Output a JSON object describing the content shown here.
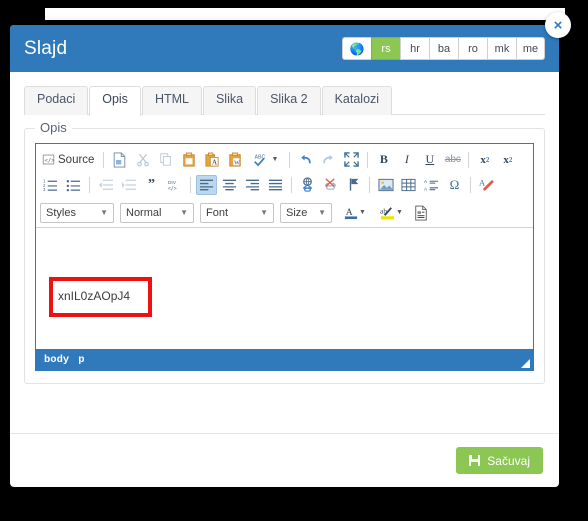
{
  "modal": {
    "title": "Slajd",
    "close_label": "×",
    "languages": [
      {
        "label": "globe-icon",
        "active": false,
        "is_icon": true
      },
      {
        "label": "rs",
        "active": true
      },
      {
        "label": "hr",
        "active": false
      },
      {
        "label": "ba",
        "active": false
      },
      {
        "label": "ro",
        "active": false
      },
      {
        "label": "mk",
        "active": false
      },
      {
        "label": "me",
        "active": false
      }
    ],
    "tabs": [
      {
        "label": "Podaci",
        "active": false
      },
      {
        "label": "Opis",
        "active": true
      },
      {
        "label": "HTML",
        "active": false
      },
      {
        "label": "Slika",
        "active": false
      },
      {
        "label": "Slika 2",
        "active": false
      },
      {
        "label": "Katalozi",
        "active": false
      }
    ],
    "fieldset_legend": "Opis",
    "footer": {
      "save_label": "Sačuvaj",
      "save_icon": "floppy-disk-icon",
      "save_color": "#8cc653"
    },
    "header_color": "#3079ba"
  },
  "editor": {
    "source_label": "Source",
    "content_text": "xnIL0zAOpJ4",
    "annotation_color": "#ee1111",
    "elements_path": [
      "body",
      "p"
    ],
    "toolbar_row1": [
      "source-button",
      "new-page-icon",
      "cut-icon",
      "copy-icon",
      "paste-icon",
      "paste-text-icon",
      "paste-word-icon",
      "spellcheck-icon",
      "undo-icon",
      "redo-icon",
      "maximize-icon",
      "bold-icon",
      "italic-icon",
      "underline-icon",
      "strikethrough-icon",
      "subscript-icon",
      "superscript-icon"
    ],
    "toolbar_row2": [
      "numbered-list-icon",
      "bulleted-list-icon",
      "outdent-icon",
      "indent-icon",
      "blockquote-icon",
      "div-container-icon",
      "align-left-icon",
      "align-center-icon",
      "align-right-icon",
      "justify-icon",
      "link-icon",
      "unlink-icon",
      "anchor-icon",
      "image-icon",
      "table-icon",
      "horizontal-rule-icon",
      "special-char-icon",
      "remove-format-icon"
    ],
    "dropdowns": [
      {
        "label": "Styles",
        "name": "styles-dropdown"
      },
      {
        "label": "Normal",
        "name": "format-dropdown"
      },
      {
        "label": "Font",
        "name": "font-dropdown"
      },
      {
        "label": "Size",
        "name": "size-dropdown"
      }
    ],
    "color_buttons": [
      "text-color-icon",
      "background-color-icon",
      "templates-icon"
    ],
    "labels": {
      "bold": "B",
      "italic": "I",
      "underline": "U",
      "strike": "abc",
      "sub": "x",
      "sup": "x",
      "sub_n": "2",
      "sup_n": "2",
      "quote": "”",
      "div": "DIV",
      "omega": "Ω",
      "abc": "ABC",
      "text_color_a": "A",
      "bg_color_a": "ab"
    }
  }
}
